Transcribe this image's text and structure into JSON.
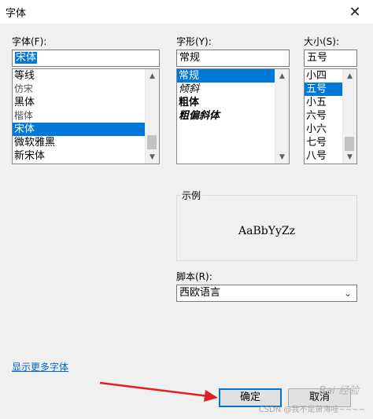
{
  "window": {
    "title": "字体",
    "close_glyph": "✕"
  },
  "font": {
    "label": "字体(F):",
    "value": "宋体",
    "items": [
      "等线",
      "仿宋",
      "黑体",
      "楷体",
      "宋体",
      "微软雅黑",
      "新宋体"
    ],
    "selected_index": 4
  },
  "style": {
    "label": "字形(Y):",
    "value": "常规",
    "items": [
      "常规",
      "倾斜",
      "粗体",
      "粗偏斜体"
    ],
    "selected_index": 0
  },
  "size": {
    "label": "大小(S):",
    "value": "五号",
    "items": [
      "小四",
      "五号",
      "小五",
      "六号",
      "小六",
      "七号",
      "八号"
    ],
    "selected_index": 1
  },
  "sample": {
    "label": "示例",
    "text": "AaBbYyZz"
  },
  "script": {
    "label": "脚本(R):",
    "value": "西欧语言"
  },
  "more_fonts_link": "显示更多字体",
  "buttons": {
    "ok": "确定",
    "cancel": "取消"
  },
  "watermark": {
    "text": "Bai 经验",
    "credit": "CSDN @我不是萧海哇~~~~"
  },
  "colors": {
    "selection": "#0078d7",
    "link": "#0066cc",
    "arrow": "#e02020"
  }
}
